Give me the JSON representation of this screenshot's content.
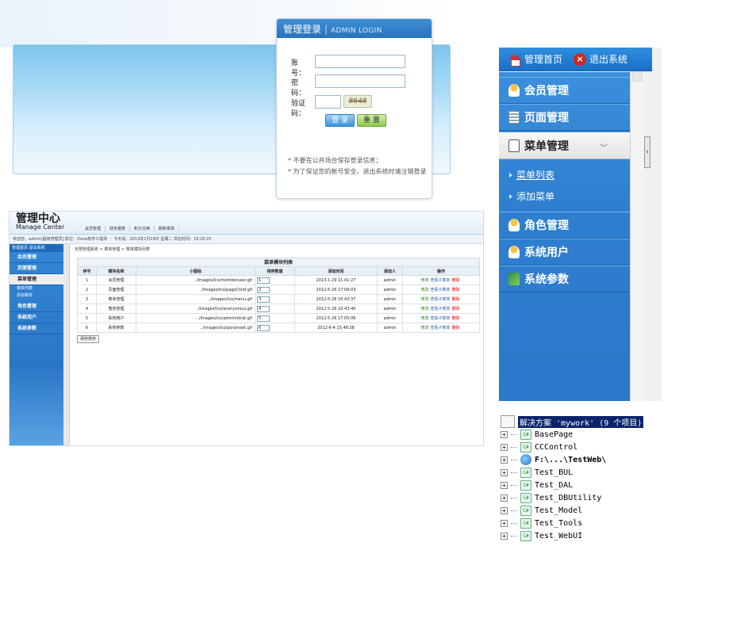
{
  "login": {
    "title": "管理登录",
    "title_en": "ADMIN LOGIN",
    "account_label": "账　号：",
    "password_label": "密　码：",
    "captcha_label": "验证码：",
    "captcha_text": "8648",
    "login_button": "登 录",
    "reset_button": "重 置",
    "tips": [
      "* 不要在公共场合保存登录信息；",
      "* 为了保证您的帐号安全，退出系统时请注销登录"
    ]
  },
  "sidebar": {
    "home_label": "管理首页",
    "exit_label": "退出系统",
    "items": [
      {
        "label": "会员管理",
        "icon": "user-icon"
      },
      {
        "label": "页面管理",
        "icon": "list-icon"
      },
      {
        "label": "菜单管理",
        "icon": "document-icon",
        "active": true
      },
      {
        "label": "角色管理",
        "icon": "user-icon"
      },
      {
        "label": "系统用户",
        "icon": "user-icon"
      },
      {
        "label": "系统参数",
        "icon": "param-icon"
      }
    ],
    "subitems": [
      {
        "label": "菜单列表",
        "selected": true
      },
      {
        "label": "添加菜单"
      }
    ]
  },
  "solution": {
    "root": "解决方案 'mywork' (9 个项目)",
    "projects": [
      "BasePage",
      "CCControl",
      "F:\\...\\TestWeb\\",
      "Test_BUL",
      "Test_DAL",
      "Test_DBUtility",
      "Test_Model",
      "Test_Tools",
      "Test_WebUI"
    ]
  },
  "admin": {
    "brand_cn": "管理中心",
    "brand_en": "Manage Center",
    "nav": [
      "会员管理",
      "财务报表",
      "积分兑换",
      "刷新菜单"
    ],
    "status": "欢迎您，admin[超级管理员] 职位：Done软件工程师 ｜ 今天是：2013年1月29日 星期二 现在时间：15:20:25",
    "left_head": "管理首页  退出系统",
    "left_items": [
      "会员管理",
      "页面管理",
      "菜单管理",
      "角色管理",
      "系统用户",
      "系统参数"
    ],
    "left_sub": [
      "菜单列表",
      "添加菜单"
    ],
    "crumb": "无限管理系统 > 菜单管理 > 菜单模块列表",
    "table_caption": "菜单模块列表",
    "headers": [
      "序号",
      "模块名称",
      "小图标",
      "排序数值",
      "添加时间",
      "添加人",
      "操作"
    ],
    "rows": [
      {
        "no": "1",
        "name": "会员管理",
        "icon": "../Images/Ico/memberuser.gif",
        "sort": "1",
        "time": "2013-1-29 11:41:27",
        "by": "admin"
      },
      {
        "no": "2",
        "name": "页面管理",
        "icon": "../Images/Ico/pageChild.gif",
        "sort": "2",
        "time": "2012-5-26 17:06:03",
        "by": "admin"
      },
      {
        "no": "3",
        "name": "菜单管理",
        "icon": "../Images/Ico/menu.gif",
        "sort": "3",
        "time": "2012-5-26 16:43:37",
        "by": "admin"
      },
      {
        "no": "4",
        "name": "角色管理",
        "icon": "../Images/Ico/anonymous.gif",
        "sort": "4",
        "time": "2012-5-26 16:43:40",
        "by": "admin"
      },
      {
        "no": "5",
        "name": "系统用户",
        "icon": "../Images/Ico/administrat.gif",
        "sort": "5",
        "time": "2012-5-26 17:05:06",
        "by": "admin"
      },
      {
        "no": "6",
        "name": "系统参数",
        "icon": "../Images/Ico/paramset.gif",
        "sort": "6",
        "time": "2012-6-4 15:48:38",
        "by": "admin"
      }
    ],
    "ops": {
      "edit": "修改",
      "view": "查看子菜单",
      "del": "删除"
    },
    "save_button": "保存排序"
  }
}
